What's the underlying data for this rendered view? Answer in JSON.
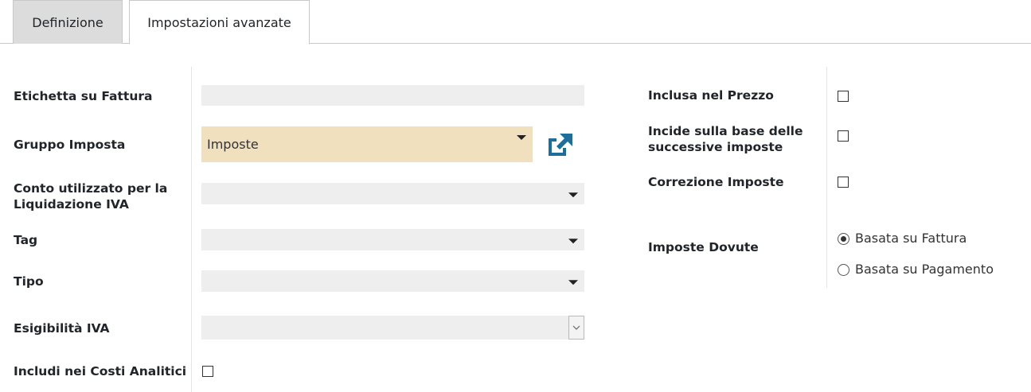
{
  "tabs": [
    {
      "label": "Definizione",
      "active": false
    },
    {
      "label": "Impostazioni avanzate",
      "active": true
    }
  ],
  "left": {
    "invoice_label": {
      "label": "Etichetta su Fattura",
      "value": ""
    },
    "tax_group": {
      "label": "Gruppo Imposta",
      "value": "Imposte",
      "external_icon": "external-link-icon"
    },
    "settlement_account": {
      "label_line1": "Conto utilizzato per la",
      "label_line2": "Liquidazione IVA",
      "value": ""
    },
    "tag": {
      "label": "Tag",
      "value": ""
    },
    "type": {
      "label": "Tipo",
      "value": ""
    },
    "vat_exigibility": {
      "label": "Esigibilità IVA",
      "value": ""
    },
    "analytic_costs": {
      "label": "Includi nei Costi Analitici",
      "checked": false
    }
  },
  "right": {
    "price_include": {
      "label": "Inclusa nel Prezzo",
      "checked": false
    },
    "base_affected": {
      "label_line1": "Incide sulla base delle",
      "label_line2": "successive imposte",
      "checked": false
    },
    "tax_adjustment": {
      "label": "Correzione Imposte",
      "checked": false
    },
    "tax_due": {
      "label": "Imposte Dovute",
      "options": [
        {
          "label": "Basata su Fattura",
          "selected": true
        },
        {
          "label": "Basata su Pagamento",
          "selected": false
        }
      ]
    }
  },
  "colors": {
    "accent": "#1f6d9a",
    "warning_field": "#f0e0bd",
    "field_bg": "#eeeeee"
  }
}
